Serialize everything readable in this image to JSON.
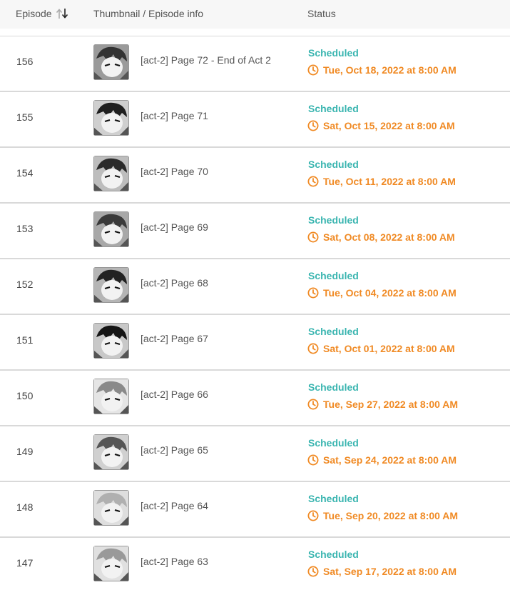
{
  "header": {
    "episode": "Episode",
    "thumbnail": "Thumbnail / Episode info",
    "status": "Status"
  },
  "colors": {
    "status": "#3ab5b0",
    "schedule": "#f08a24"
  },
  "icons": {
    "sort": "sort-arrows-icon",
    "clock": "clock-icon",
    "thumbnail": "manga-panel-thumbnail"
  },
  "rows": [
    {
      "episode": "156",
      "title": "[act-2] Page 72 - End of Act 2",
      "status": "Scheduled",
      "schedule": "Tue, Oct 18, 2022 at 8:00 AM"
    },
    {
      "episode": "155",
      "title": "[act-2] Page 71",
      "status": "Scheduled",
      "schedule": "Sat, Oct 15, 2022 at 8:00 AM"
    },
    {
      "episode": "154",
      "title": "[act-2] Page 70",
      "status": "Scheduled",
      "schedule": "Tue, Oct 11, 2022 at 8:00 AM"
    },
    {
      "episode": "153",
      "title": "[act-2] Page 69",
      "status": "Scheduled",
      "schedule": "Sat, Oct 08, 2022 at 8:00 AM"
    },
    {
      "episode": "152",
      "title": "[act-2] Page 68",
      "status": "Scheduled",
      "schedule": "Tue, Oct 04, 2022 at 8:00 AM"
    },
    {
      "episode": "151",
      "title": "[act-2] Page 67",
      "status": "Scheduled",
      "schedule": "Sat, Oct 01, 2022 at 8:00 AM"
    },
    {
      "episode": "150",
      "title": "[act-2] Page 66",
      "status": "Scheduled",
      "schedule": "Tue, Sep 27, 2022 at 8:00 AM"
    },
    {
      "episode": "149",
      "title": "[act-2] Page 65",
      "status": "Scheduled",
      "schedule": "Sat, Sep 24, 2022 at 8:00 AM"
    },
    {
      "episode": "148",
      "title": "[act-2] Page 64",
      "status": "Scheduled",
      "schedule": "Tue, Sep 20, 2022 at 8:00 AM"
    },
    {
      "episode": "147",
      "title": "[act-2] Page 63",
      "status": "Scheduled",
      "schedule": "Sat, Sep 17, 2022 at 8:00 AM"
    }
  ]
}
